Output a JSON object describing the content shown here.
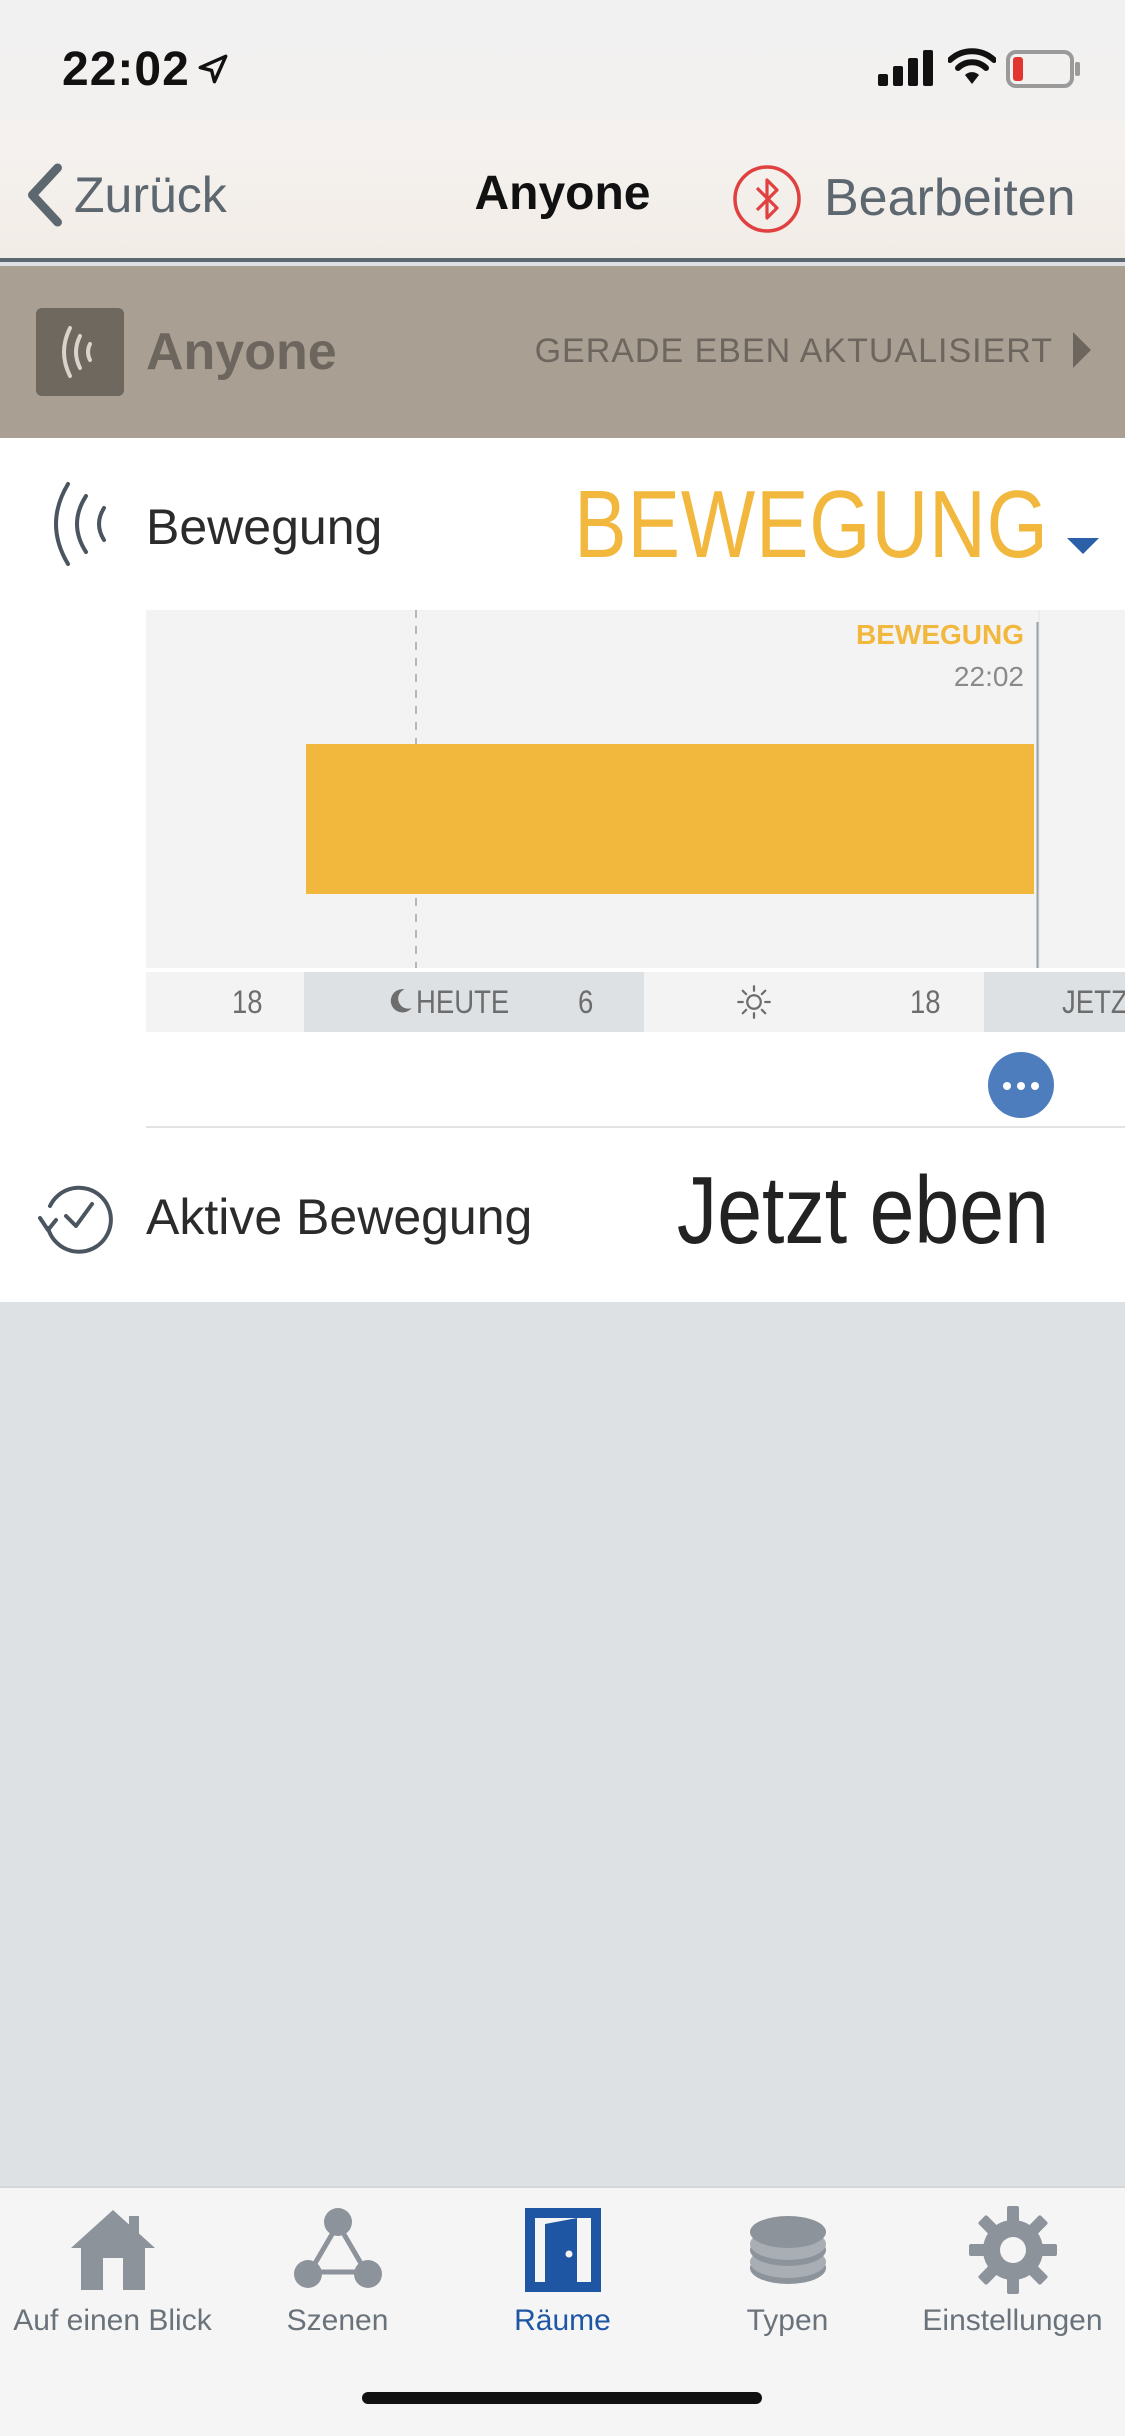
{
  "status_bar": {
    "time": "22:02"
  },
  "nav": {
    "back_label": "Zurück",
    "title": "Anyone",
    "edit_label": "Bearbeiten"
  },
  "device_bar": {
    "name": "Anyone",
    "updated_label": "GERADE EBEN AKTUALISIERT"
  },
  "motion": {
    "label": "Bewegung",
    "value": "BEWEGUNG"
  },
  "chart": {
    "marker_label": "BEWEGUNG",
    "marker_time": "22:02",
    "axis": {
      "t1": "18",
      "today": "HEUTE",
      "t2": "6",
      "t3": "18",
      "now": "JETZT"
    }
  },
  "chart_data": {
    "type": "area",
    "title": "",
    "categories": [
      "18",
      "HEUTE",
      "6",
      "18",
      "JETZT"
    ],
    "series": [
      {
        "name": "BEWEGUNG",
        "state": "BEWEGUNG",
        "end": "22:02"
      }
    ],
    "colors": {
      "motion": "#f2b73d",
      "night_band": "#dde1e4"
    }
  },
  "active_motion": {
    "label": "Aktive Bewegung",
    "value": "Jetzt eben"
  },
  "tabs": [
    {
      "label": "Auf einen Blick",
      "icon": "home-icon",
      "active": false
    },
    {
      "label": "Szenen",
      "icon": "scenes-icon",
      "active": false
    },
    {
      "label": "Räume",
      "icon": "door-icon",
      "active": true
    },
    {
      "label": "Typen",
      "icon": "layers-icon",
      "active": false
    },
    {
      "label": "Einstellungen",
      "icon": "gear-icon",
      "active": false
    }
  ],
  "colors": {
    "accent": "#f2b73d",
    "active_tab": "#1f56a4",
    "bluetooth": "#e0403f",
    "device_bar": "#aa9f93"
  }
}
